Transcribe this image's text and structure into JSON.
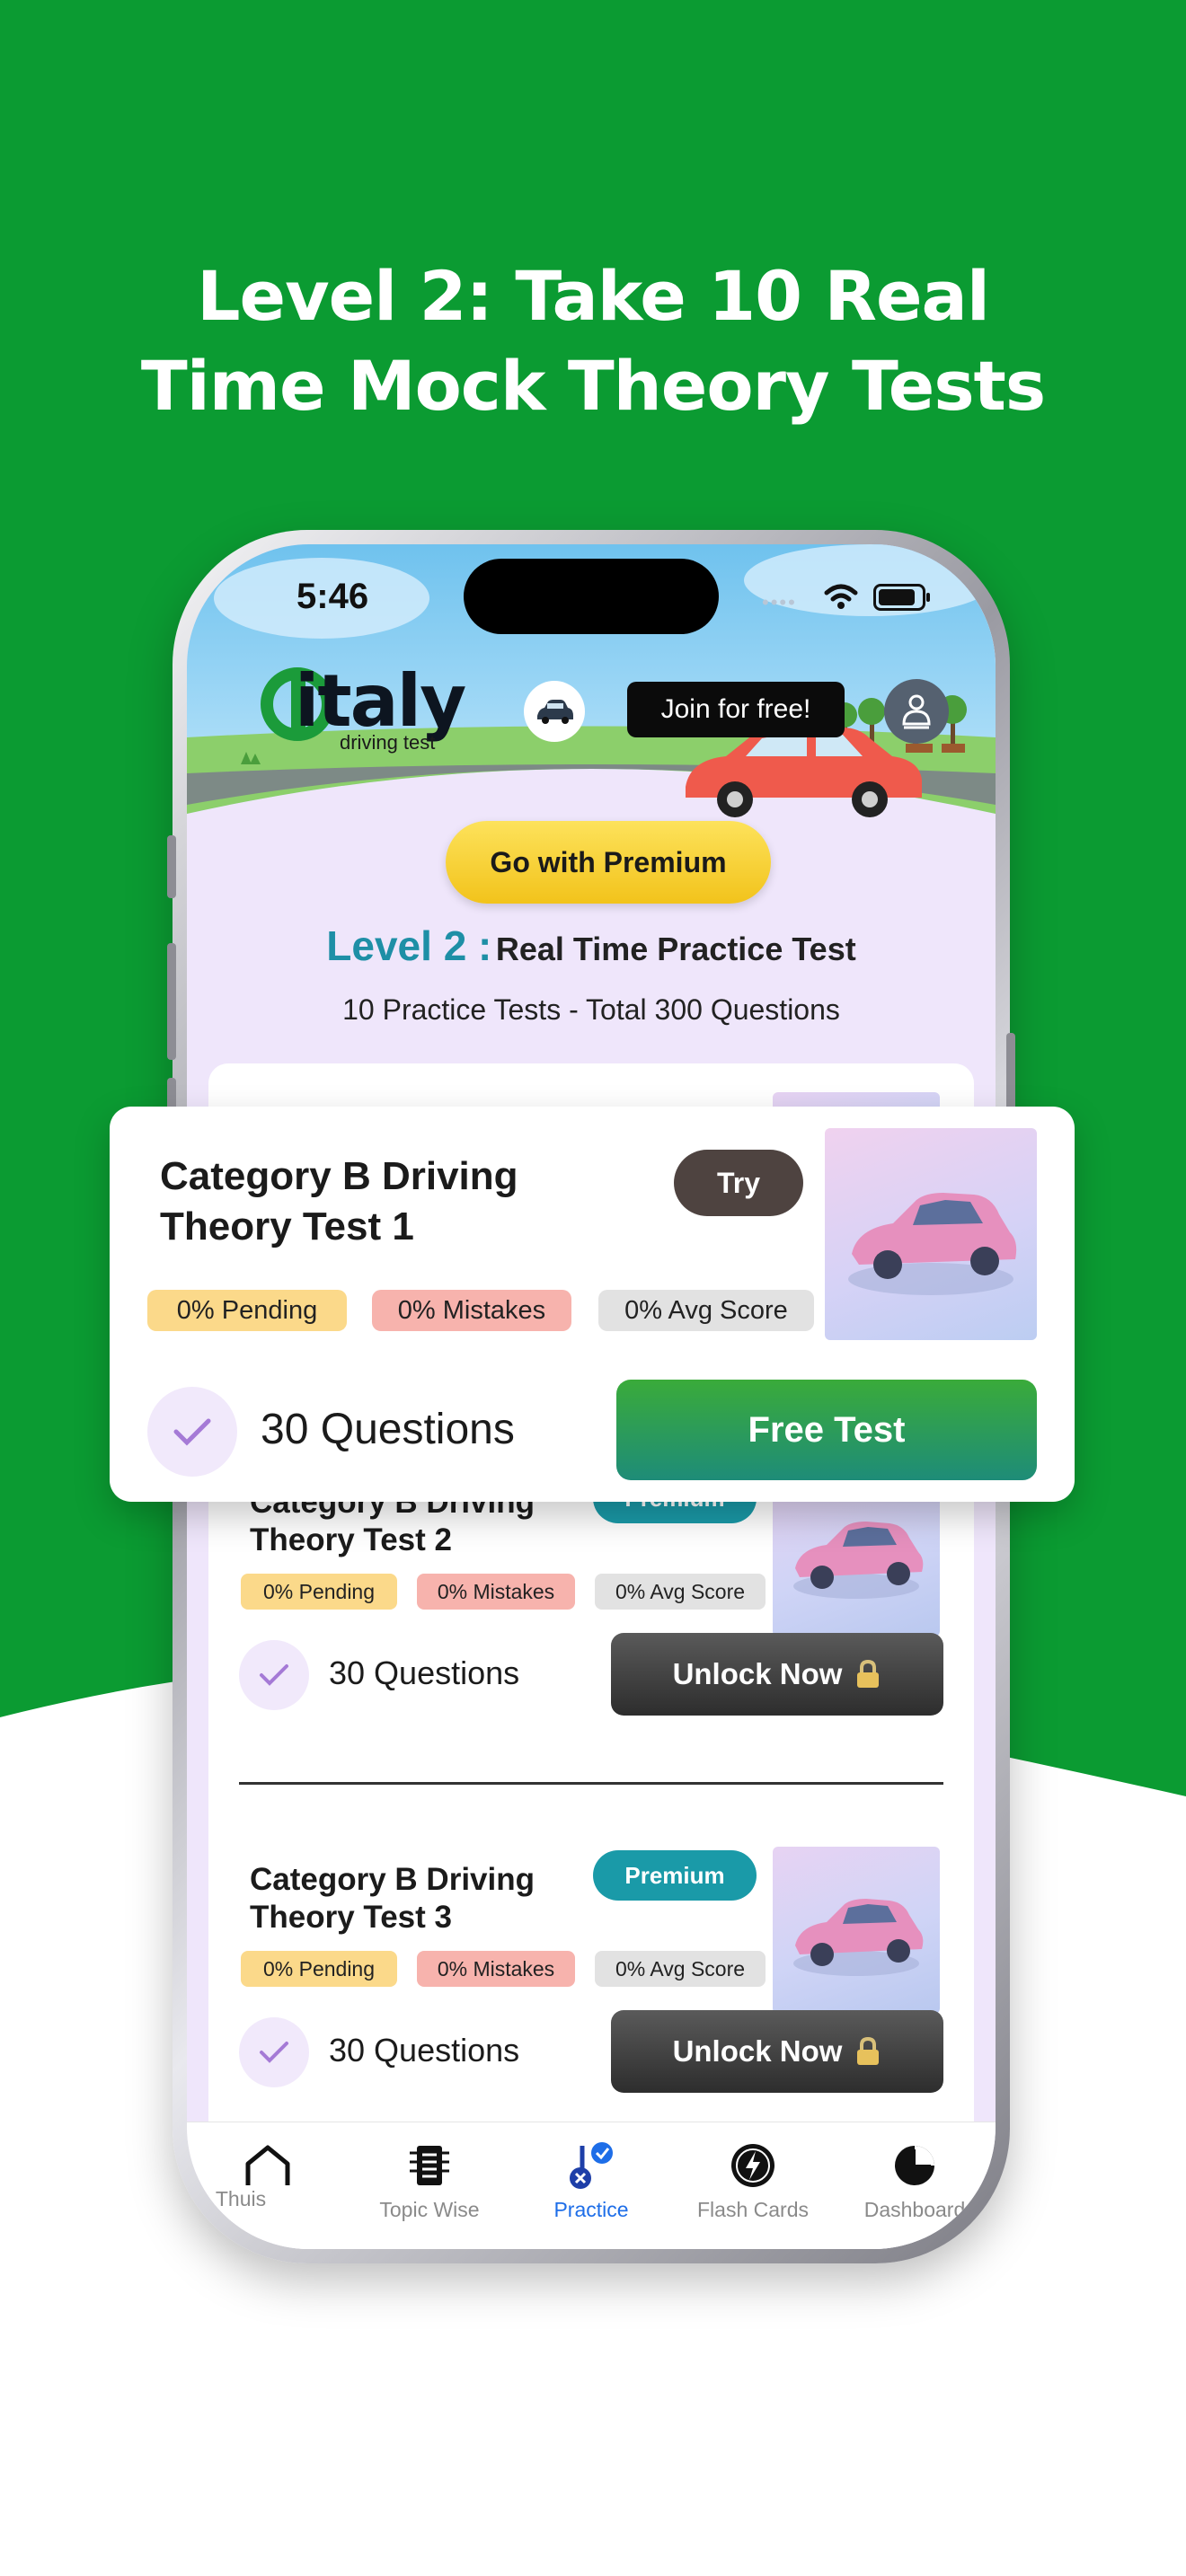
{
  "colors": {
    "brand_green": "#0b9b32",
    "accent_teal": "#1a9aa8",
    "premium_yellow": "#f6ca2a",
    "active_tab": "#1e6ee8"
  },
  "headline": {
    "line1": "Level 2: Take 10 Real",
    "line2": "Time Mock Theory Tests"
  },
  "status_bar": {
    "time": "5:46"
  },
  "app_header": {
    "logo_text": "italy",
    "logo_subtitle": "driving test",
    "join_label": "Join for free!",
    "car_icon": "car-icon",
    "profile_icon": "user-icon"
  },
  "premium_cta": {
    "label": "Go with Premium"
  },
  "level": {
    "prefix": "Level 2 :",
    "title": "Real Time Practice Test",
    "subtitle": "10 Practice Tests - Total 300 Questions"
  },
  "featured_test": {
    "title_line1": "Category B Driving",
    "title_line2": "Theory Test 1",
    "try_label": "Try",
    "pending": "0% Pending",
    "mistakes": "0% Mistakes",
    "avg_score": "0% Avg Score",
    "questions": "30 Questions",
    "action_label": "Free Test"
  },
  "tests": [
    {
      "title_line1": "Category B Driving",
      "title_line2": "Theory Test 2",
      "badge": "Premium",
      "pending": "0% Pending",
      "mistakes": "0% Mistakes",
      "avg_score": "0% Avg Score",
      "questions": "30 Questions",
      "action_label": "Unlock Now"
    },
    {
      "title_line1": "Category B Driving",
      "title_line2": "Theory Test 3",
      "badge": "Premium",
      "pending": "0% Pending",
      "mistakes": "0% Mistakes",
      "avg_score": "0% Avg Score",
      "questions": "30 Questions",
      "action_label": "Unlock Now"
    }
  ],
  "tabbar": {
    "items": [
      {
        "label": "Thuis",
        "icon": "home-icon"
      },
      {
        "label": "Topic Wise",
        "icon": "book-icon"
      },
      {
        "label": "Practice",
        "icon": "practice-icon",
        "active": true
      },
      {
        "label": "Flash Cards",
        "icon": "flash-icon"
      },
      {
        "label": "Dashboard",
        "icon": "pie-chart-icon"
      }
    ]
  }
}
